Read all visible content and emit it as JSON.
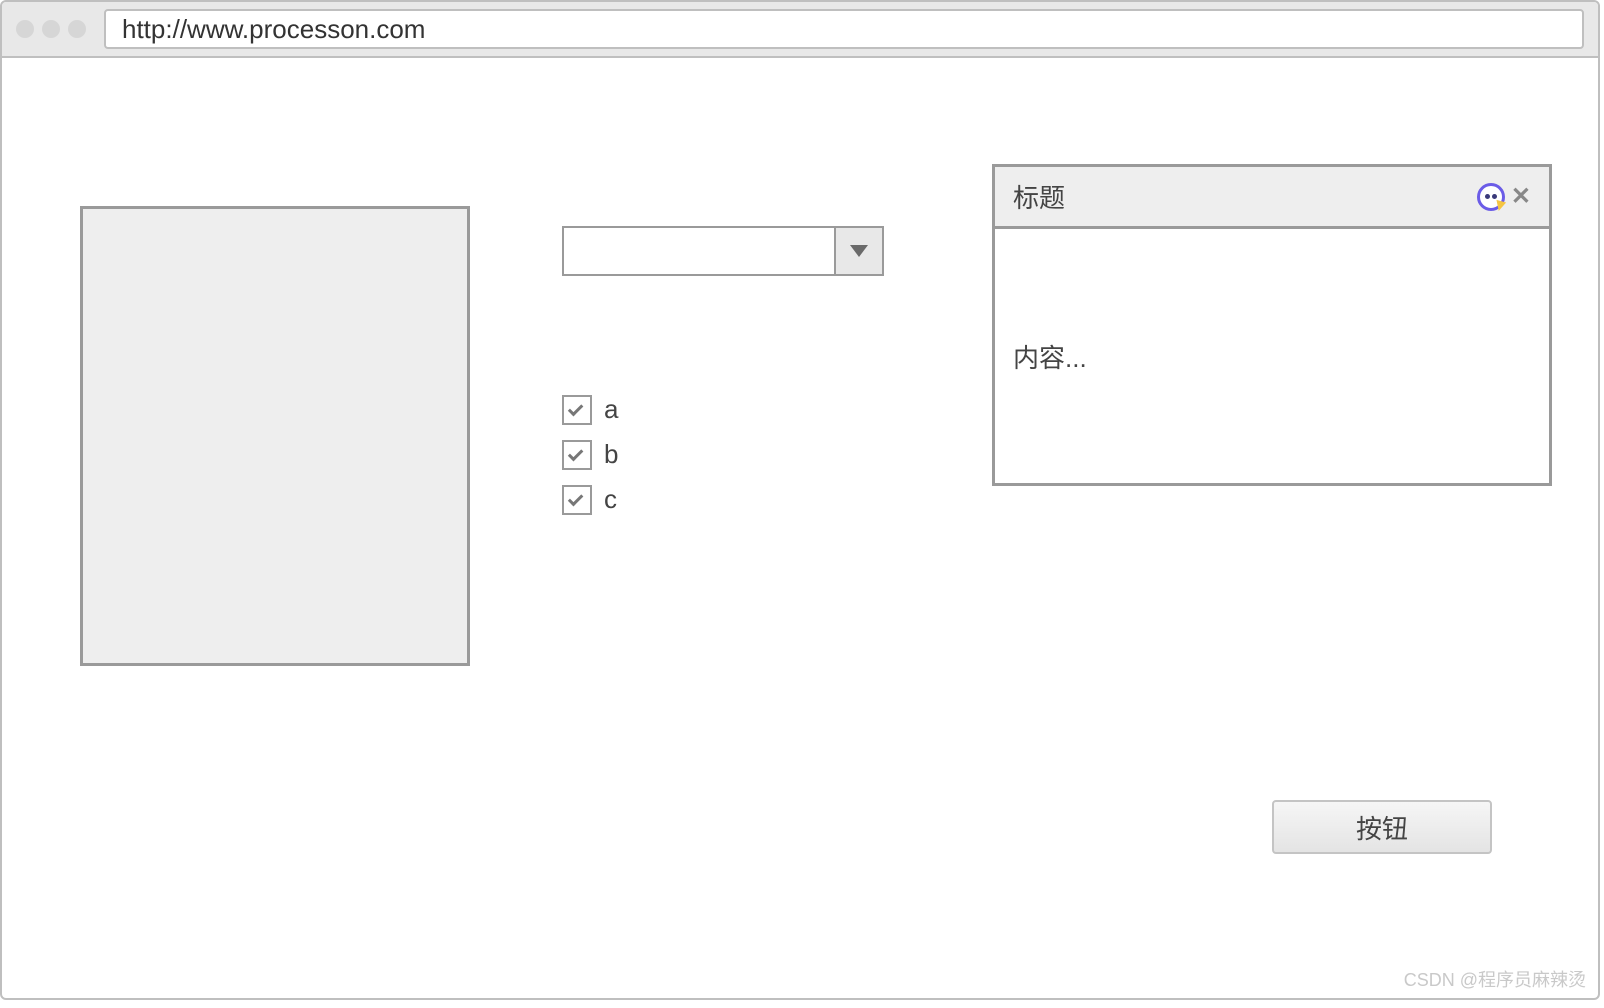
{
  "browser": {
    "url": "http://www.processon.com"
  },
  "combo": {
    "value": ""
  },
  "checkboxes": [
    {
      "label": "a",
      "checked": true
    },
    {
      "label": "b",
      "checked": true
    },
    {
      "label": "c",
      "checked": true
    }
  ],
  "panel": {
    "title": "标题",
    "content": "内容..."
  },
  "button": {
    "label": "按钮"
  },
  "watermark": "CSDN @程序员麻辣烫"
}
